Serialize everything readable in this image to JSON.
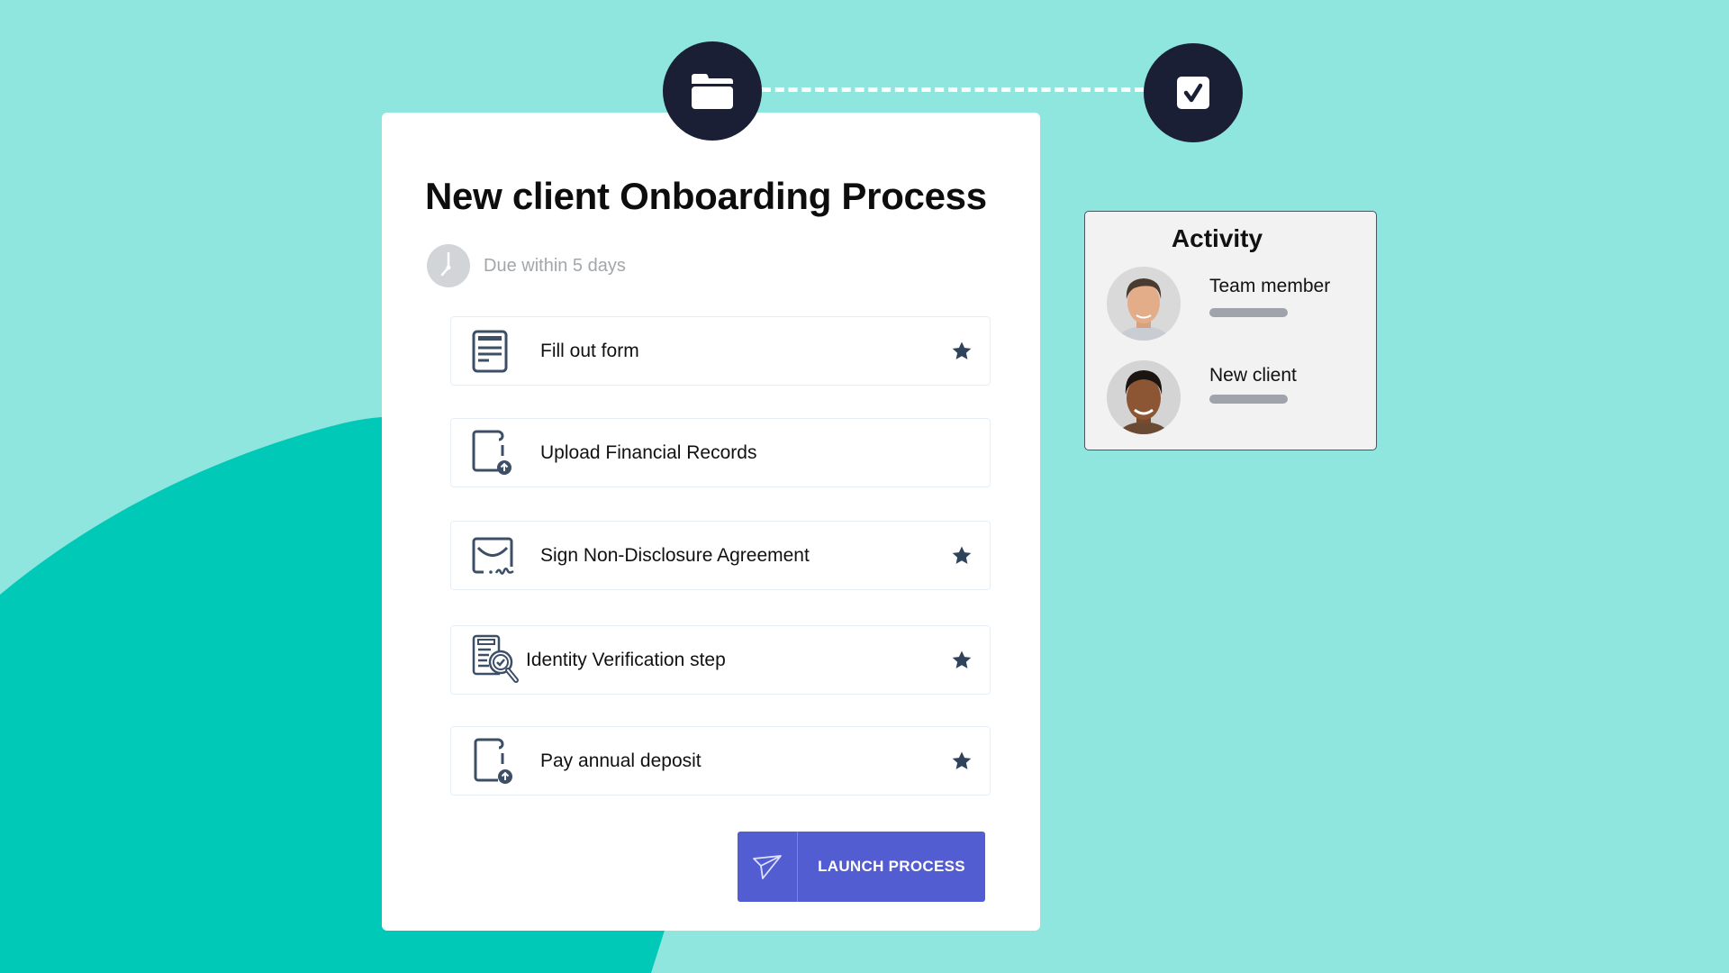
{
  "colors": {
    "background_light": "#8ee6df",
    "background_blob": "#00c9b7",
    "step_circle": "#1a1f36",
    "icon_dark": "#3d4f66",
    "button": "#525dd1"
  },
  "progress_steps": [
    {
      "icon": "folder-icon"
    },
    {
      "icon": "checkbox-checked-icon"
    }
  ],
  "process": {
    "title": "New client Onboarding Process",
    "due_icon": "clock-icon",
    "due_text": "Due within 5 days",
    "tasks": [
      {
        "label": "Fill out form",
        "icon": "form-document-icon",
        "starred": true
      },
      {
        "label": "Upload Financial Records",
        "icon": "file-upload-icon",
        "starred": false
      },
      {
        "label": "Sign Non-Disclosure Agreement",
        "icon": "envelope-signature-icon",
        "starred": true
      },
      {
        "label": "Identity Verification step",
        "icon": "document-search-verify-icon",
        "starred": true
      },
      {
        "label": "Pay annual deposit",
        "icon": "file-upload-icon",
        "starred": true
      }
    ],
    "launch_button": {
      "label": "LAUNCH PROCESS",
      "icon": "paper-plane-icon"
    }
  },
  "activity": {
    "title": "Activity",
    "people": [
      {
        "name": "Team member",
        "avatar": "avatar-team-member"
      },
      {
        "name": "New client",
        "avatar": "avatar-new-client"
      }
    ]
  }
}
